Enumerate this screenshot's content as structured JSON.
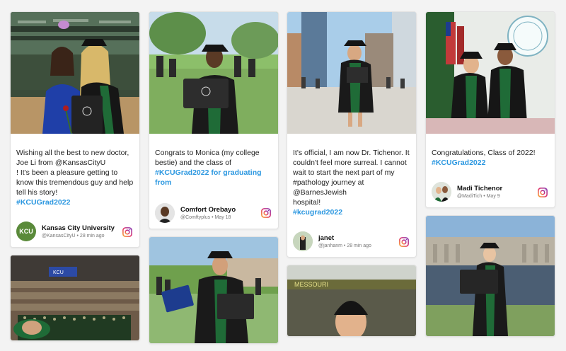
{
  "posts": [
    {
      "caption": "Wishing all the best to new doctor, Joe Li from @KansasCityU\n! It's been a pleasure getting to know this tremendous guy and help tell his story!",
      "hashtag": "#KCUGrad2022",
      "author": "Kansas City University",
      "handle": "@KansasCityU",
      "time": "28 min ago",
      "avatar_text": "KCU",
      "source_icon": "instagram-icon"
    },
    {
      "caption": "Congrats to Monica (my college bestie) and the class of",
      "hashtag": "#KCUGrad2022 for graduating from",
      "author": "Comfort Orebayo",
      "handle": "@Comftyplus",
      "time": "May 18",
      "source_icon": "instagram-icon"
    },
    {
      "caption": "It's official, I am now Dr. Tichenor. It couldn't feel more surreal. I cannot wait to start the next part of my #pathology journey at @BarnesJewish\n hospital!",
      "hashtag": "#kcugrad2022",
      "author": "janet",
      "handle": "@janhanm",
      "time": "28 min ago",
      "source_icon": "instagram-icon"
    },
    {
      "caption": "Congratulations, Class of 2022!",
      "hashtag": "#KCUGrad2022",
      "author": "Madi Tichenor",
      "handle": "@MadiTich",
      "time": "May 9",
      "source_icon": "instagram-icon"
    }
  ],
  "photo_texts": {
    "kcu_banner": "KCU",
    "building_sign": "MESSOURI"
  },
  "colors": {
    "hashtag": "#2b97e0",
    "kcu_green": "#5a8a3a",
    "robe": "#1c1c1c",
    "velvet": "#1f6b37"
  }
}
